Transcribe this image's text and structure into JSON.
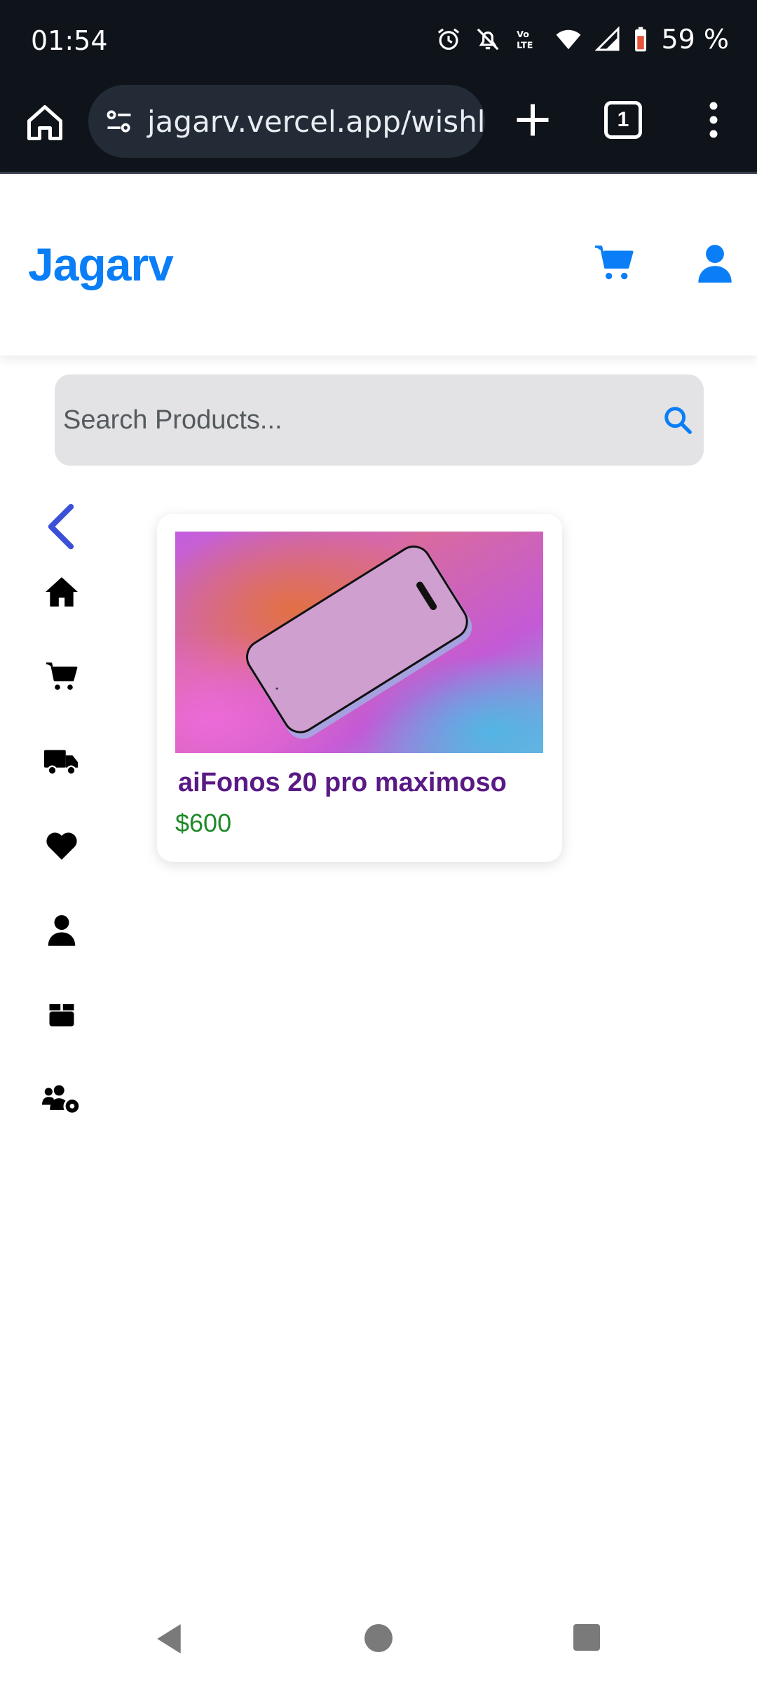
{
  "status_bar": {
    "time": "01:54",
    "battery": "59 %",
    "icons": [
      "alarm-icon",
      "bell-off-icon",
      "volte-icon",
      "wifi-icon",
      "signal-icon",
      "battery-icon"
    ]
  },
  "browser": {
    "url": "jagarv.vercel.app/wishlist",
    "tab_count": "1",
    "icons": [
      "home-icon",
      "site-settings-icon",
      "new-tab-icon",
      "tabs-icon",
      "more-menu-icon"
    ]
  },
  "header": {
    "logo": "Jagarv",
    "brand_color": "#0a7ef7",
    "icons": [
      "cart-icon",
      "user-icon"
    ]
  },
  "search": {
    "placeholder": "Search Products..."
  },
  "sidebar": {
    "items": [
      {
        "name": "home",
        "icon": "home-icon"
      },
      {
        "name": "cart",
        "icon": "cart-icon"
      },
      {
        "name": "orders",
        "icon": "truck-icon"
      },
      {
        "name": "wishlist",
        "icon": "heart-icon"
      },
      {
        "name": "profile",
        "icon": "user-icon"
      },
      {
        "name": "products",
        "icon": "box-icon"
      },
      {
        "name": "admin-users",
        "icon": "users-gear-icon"
      }
    ]
  },
  "wishlist": {
    "products": [
      {
        "title": "aiFonos 20 pro maximoso",
        "price": "$600"
      }
    ]
  },
  "colors": {
    "title": "#5a1a86",
    "price": "#1f8a2a",
    "back_arrow": "#3b4fd8"
  }
}
